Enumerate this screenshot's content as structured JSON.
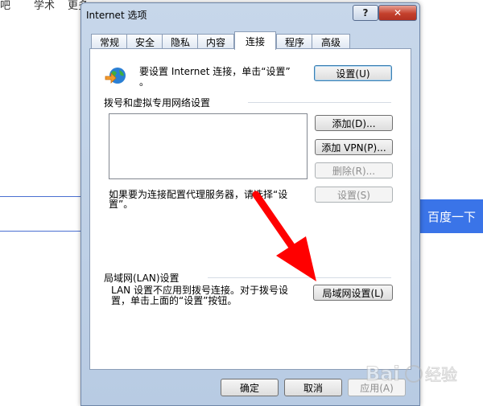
{
  "background": {
    "nav_items": [
      "吧",
      "学术",
      "更多"
    ],
    "search_button": "百度一下",
    "watermark_text": "Bai 经验"
  },
  "dialog": {
    "title": "Internet 选项",
    "help_label": "?",
    "close_label": "✕",
    "tabs": [
      {
        "label": "常规"
      },
      {
        "label": "安全"
      },
      {
        "label": "隐私"
      },
      {
        "label": "内容"
      },
      {
        "label": "连接"
      },
      {
        "label": "程序"
      },
      {
        "label": "高级"
      }
    ],
    "active_tab": "连接",
    "connection": {
      "setup_text_1": "要设置 Internet 连接，单击“设置”",
      "setup_text_2": "。",
      "setup_button": "设置(U)",
      "dialup_group_label": "拨号和虚拟专用网络设置",
      "add_button": "添加(D)...",
      "add_vpn_button": "添加 VPN(P)...",
      "remove_button": "删除(R)...",
      "proxy_text_1": "如果要为连接配置代理服务器，请选择“设",
      "proxy_text_2": "置”。",
      "settings_button": "设置(S)",
      "lan_group_label": "局域网(LAN)设置",
      "lan_text_1": "LAN 设置不应用到拨号连接。对于拨号设",
      "lan_text_2": "置，单击上面的“设置”按钮。",
      "lan_button": "局域网设置(L)"
    },
    "footer": {
      "ok_button": "确定",
      "cancel_button": "取消",
      "apply_button": "应用(A)"
    },
    "colors": {
      "annotation_arrow": "#ff0000",
      "accent": "#3a74e8"
    }
  }
}
